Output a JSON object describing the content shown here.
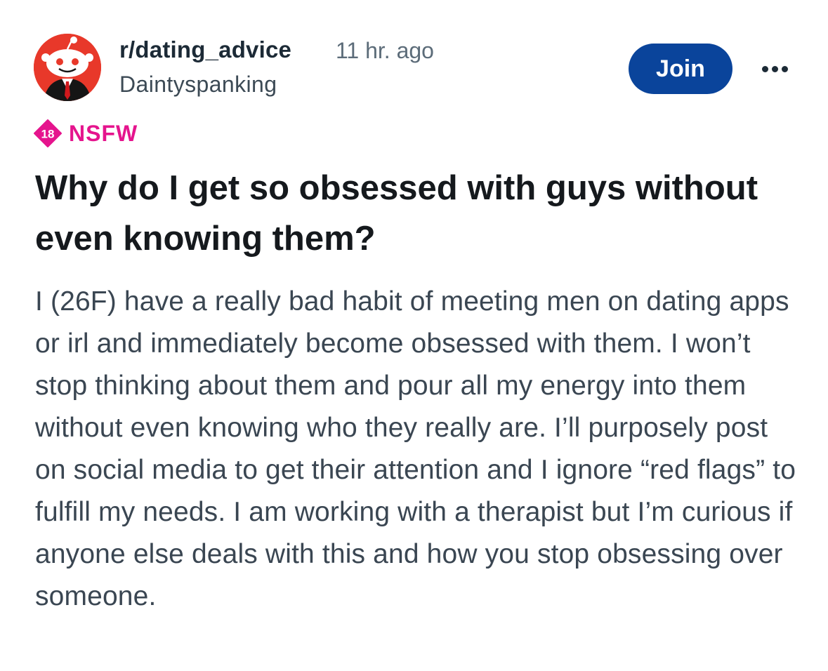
{
  "post": {
    "subreddit": "r/dating_advice",
    "time_ago": "11 hr. ago",
    "author": "Daintyspanking",
    "join_label": "Join",
    "more_icon": "more-horizontal-icon",
    "nsfw": {
      "badge_text": "18",
      "label": "NSFW",
      "color": "#e5148d"
    },
    "title": "Why do I get so obsessed with guys without even knowing them?",
    "body": "I (26F) have a really bad habit of meeting men on dating apps or irl and immediately become obsessed with them. I won’t stop thinking about them and pour all my energy into them without even knowing who they really are. I’ll purposely post on social media to get their attention and I ignore “red flags” to fulfill my needs. I am working with a therapist but I’m curious if anyone else deals with this and how you stop obsessing over someone."
  },
  "colors": {
    "join_button": "#0a449b",
    "avatar_background": "#e8382a",
    "title_text": "#15191d",
    "body_text": "#3a4652"
  }
}
